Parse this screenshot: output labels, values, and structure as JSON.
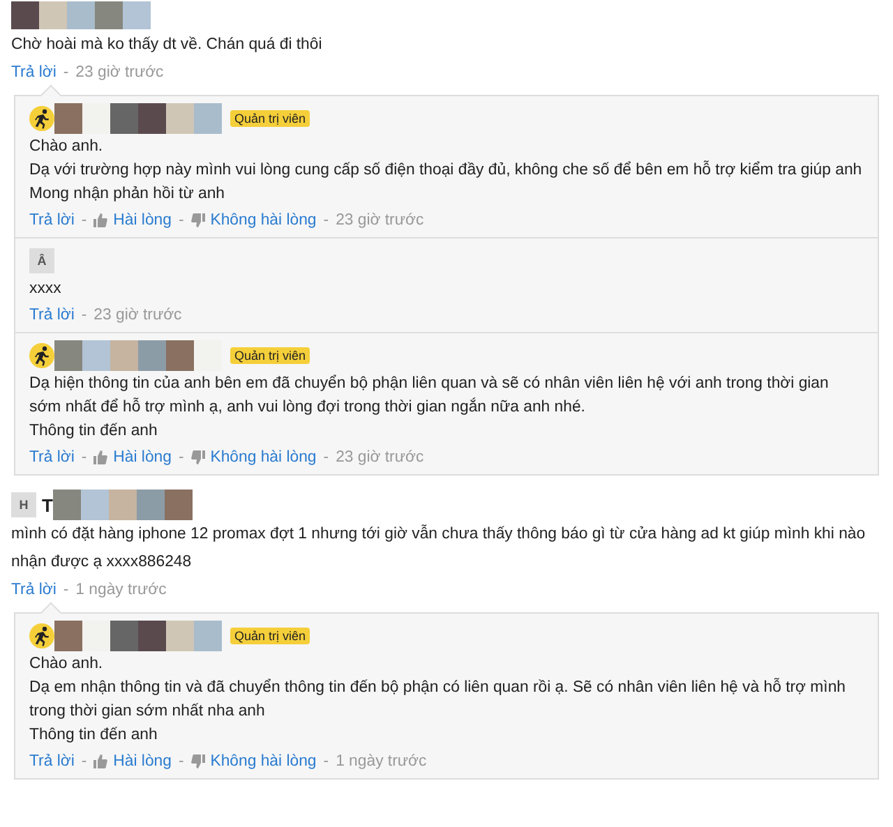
{
  "comments": [
    {
      "author": {
        "kind": "hidden"
      },
      "lines": [
        "Chờ hoài mà ko thấy dt về. Chán quá đi thôi"
      ],
      "actions": [
        {
          "kind": "reply",
          "label": "Trả lời"
        },
        {
          "kind": "sep",
          "label": "-"
        },
        {
          "kind": "time",
          "label": "23 giờ trước"
        }
      ],
      "replies": [
        {
          "kind": "admin",
          "role": "Quản trị viên",
          "lines": [
            "Chào anh.",
            "Dạ với trường hợp này mình vui lòng cung cấp số điện thoại đầy đủ, không che số để bên em hỗ trợ kiểm tra giúp anh",
            "Mong nhận phản hồi từ anh"
          ],
          "actions": [
            {
              "kind": "reply",
              "label": "Trả lời"
            },
            {
              "kind": "sep",
              "label": "-"
            },
            {
              "kind": "like",
              "label": "Hài lòng"
            },
            {
              "kind": "sep",
              "label": "-"
            },
            {
              "kind": "dislike",
              "label": "Không hài lòng"
            },
            {
              "kind": "sep",
              "label": "-"
            },
            {
              "kind": "time",
              "label": "23 giờ trước"
            }
          ]
        },
        {
          "kind": "user",
          "avatar_letter": "Â",
          "lines": [
            "xxxx"
          ],
          "actions": [
            {
              "kind": "reply",
              "label": "Trả lời"
            },
            {
              "kind": "sep",
              "label": "-"
            },
            {
              "kind": "time",
              "label": "23 giờ trước"
            }
          ]
        },
        {
          "kind": "admin",
          "role": "Quản trị viên",
          "lines": [
            "Dạ hiện thông tin của anh bên em đã chuyển bộ phận liên quan và sẽ có nhân viên liên hệ với anh trong thời gian sớm nhất để hỗ trợ mình ạ, anh vui lòng đợi trong thời gian ngắn nữa anh nhé.",
            "Thông tin đến anh"
          ],
          "actions": [
            {
              "kind": "reply",
              "label": "Trả lời"
            },
            {
              "kind": "sep",
              "label": "-"
            },
            {
              "kind": "like",
              "label": "Hài lòng"
            },
            {
              "kind": "sep",
              "label": "-"
            },
            {
              "kind": "dislike",
              "label": "Không hài lòng"
            },
            {
              "kind": "sep",
              "label": "-"
            },
            {
              "kind": "time",
              "label": "23 giờ trước"
            }
          ]
        }
      ]
    },
    {
      "author": {
        "kind": "user",
        "avatar_letter": "H",
        "name": "T"
      },
      "lines": [
        "mình có đặt hàng iphone 12 promax đợt 1 nhưng tới giờ vẫn chưa thấy thông báo gì từ cửa hàng ad kt giúp mình khi nào nhận được ạ xxxx886248"
      ],
      "actions": [
        {
          "kind": "reply",
          "label": "Trả lời"
        },
        {
          "kind": "sep",
          "label": "-"
        },
        {
          "kind": "time",
          "label": "1 ngày trước"
        }
      ],
      "replies": [
        {
          "kind": "admin",
          "role": "Quản trị viên",
          "lines": [
            "Chào anh.",
            "Dạ em nhận thông tin và đã chuyển thông tin đến bộ phận có liên quan rồi ạ. Sẽ có nhân viên liên hệ và hỗ trợ mình trong thời gian sớm nhất nha anh",
            "Thông tin đến anh"
          ],
          "actions": [
            {
              "kind": "reply",
              "label": "Trả lời"
            },
            {
              "kind": "sep",
              "label": "-"
            },
            {
              "kind": "like",
              "label": "Hài lòng"
            },
            {
              "kind": "sep",
              "label": "-"
            },
            {
              "kind": "dislike",
              "label": "Không hài lòng"
            },
            {
              "kind": "sep",
              "label": "-"
            },
            {
              "kind": "time",
              "label": "1 ngày trước"
            }
          ]
        }
      ]
    }
  ]
}
